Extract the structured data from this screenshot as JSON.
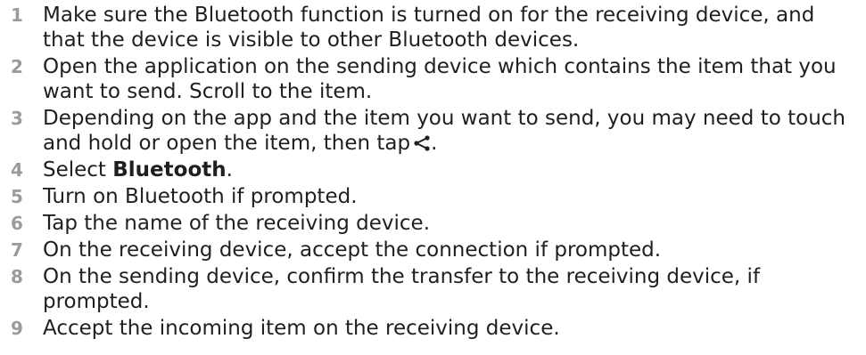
{
  "steps": [
    {
      "num": "1",
      "text": "Make sure the Bluetooth function is turned on for the receiving device, and that the device is visible to other Bluetooth devices."
    },
    {
      "num": "2",
      "text": "Open the application on the sending device which contains the item that you want to send. Scroll to the item."
    },
    {
      "num": "3",
      "text_before": "Depending on the app and the item you want to send, you may need to touch and hold or open the item, then tap",
      "text_after": ".",
      "icon": "share-icon"
    },
    {
      "num": "4",
      "text_before": "Select ",
      "bold": "Bluetooth",
      "text_after": "."
    },
    {
      "num": "5",
      "text": "Turn on Bluetooth if prompted."
    },
    {
      "num": "6",
      "text": "Tap the name of the receiving device."
    },
    {
      "num": "7",
      "text": "On the receiving device, accept the connection if prompted."
    },
    {
      "num": "8",
      "text": "On the sending device, confirm the transfer to the receiving device, if prompted."
    },
    {
      "num": "9",
      "text": "Accept the incoming item on the receiving device."
    }
  ]
}
